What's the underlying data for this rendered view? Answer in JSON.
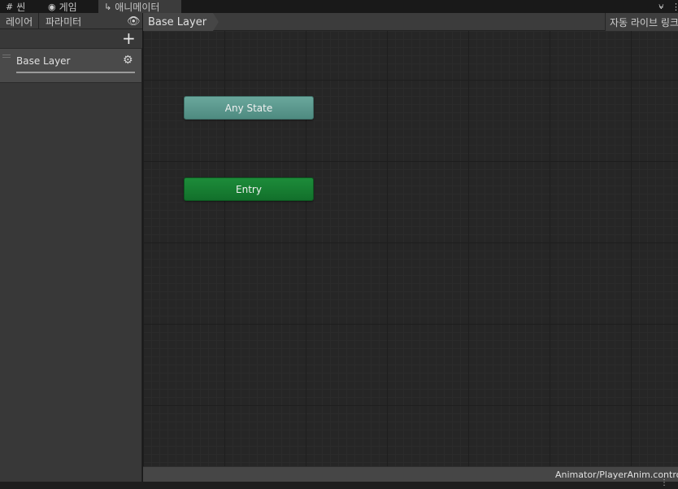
{
  "tabs": [
    {
      "label": "씬",
      "icon": "scene-grid-icon"
    },
    {
      "label": "게임",
      "icon": "gamepad-icon"
    },
    {
      "label": "애니메이터",
      "icon": "animator-icon"
    }
  ],
  "left_panel": {
    "tabs": [
      {
        "label": "레이어"
      },
      {
        "label": "파라미터"
      }
    ],
    "layers": [
      {
        "name": "Base Layer"
      }
    ]
  },
  "breadcrumb": {
    "items": [
      "Base Layer"
    ],
    "auto_live_link": "자동 라이브 링크"
  },
  "graph": {
    "nodes": [
      {
        "label": "Any State",
        "color": "#5e9a90"
      },
      {
        "label": "Entry",
        "color": "#1a7f35"
      }
    ]
  },
  "status_bar": {
    "path": "Animator/PlayerAnim.controller"
  },
  "colors": {
    "background": "#262626",
    "panel": "#383838",
    "selected_layer": "#4a4a4a"
  }
}
